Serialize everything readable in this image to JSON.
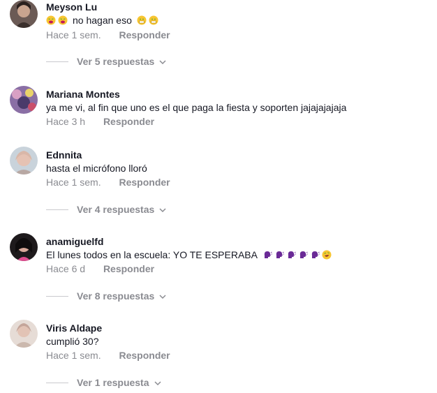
{
  "labels": {
    "reply": "Responder"
  },
  "icons": {
    "chevron": "chevron-down-icon",
    "emoji_weary": "weary-face-emoji",
    "emoji_grimace": "grimacing-face-emoji",
    "emoji_speaking": "speaking-head-emoji",
    "emoji_rofl": "rofl-emoji"
  },
  "colors": {
    "author": "#161823",
    "muted": "#8a8b91",
    "divider": "#c9c9cd",
    "purple_emoji": "#6a2a96"
  },
  "comments": [
    {
      "author": "Meyson Lu",
      "text": "no hagan eso",
      "time": "Hace 1 sem.",
      "replies": "Ver 5 respuestas"
    },
    {
      "author": "Mariana Montes",
      "text": "ya me vi, al fin que uno es el que paga la fiesta y soporten jajajajajaja",
      "time": "Hace 3 h",
      "replies": ""
    },
    {
      "author": "Ednnita",
      "text": "hasta el micrófono lloró",
      "time": "Hace 1 sem.",
      "replies": "Ver 4 respuestas"
    },
    {
      "author": "anamiguelfd",
      "text": "El lunes todos en la escuela: YO TE ESPERABA",
      "time": "Hace 6 d",
      "replies": "Ver 8 respuestas"
    },
    {
      "author": "Viris Aldape",
      "text": "cumplió 30?",
      "time": "Hace 1 sem.",
      "replies": "Ver 1 respuesta"
    }
  ]
}
